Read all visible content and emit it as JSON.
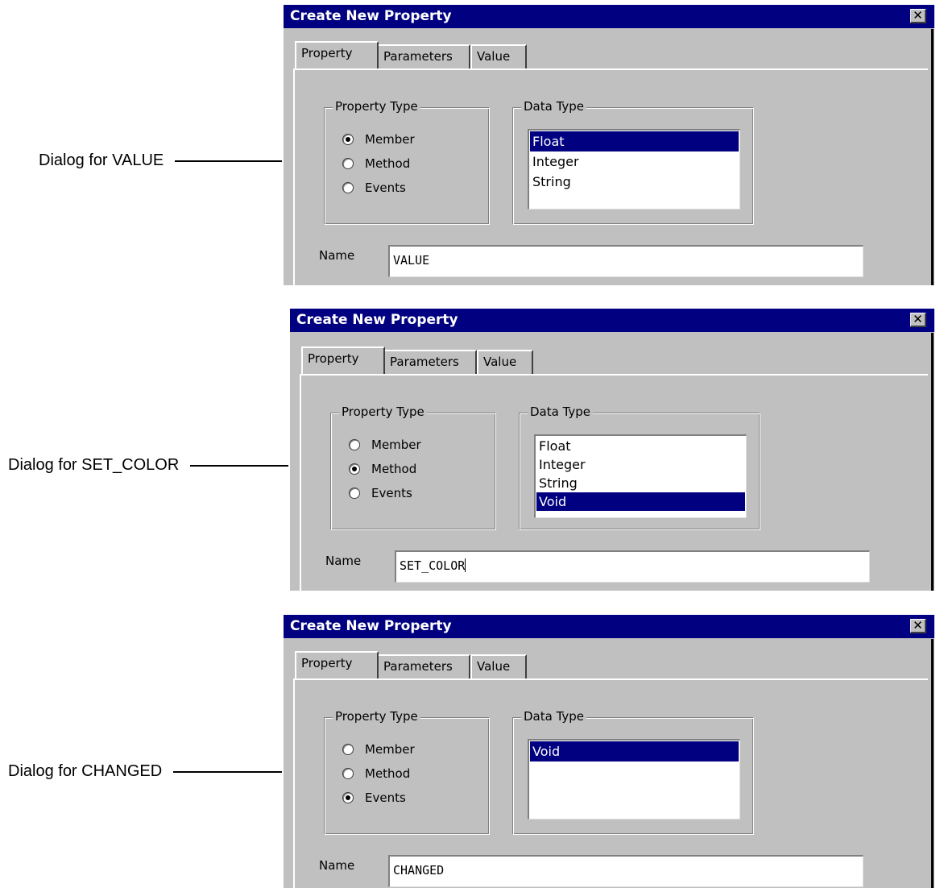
{
  "dialogs": [
    {
      "caption": "Dialog for VALUE",
      "title": "Create New Property",
      "close_glyph": "✕",
      "tabs": [
        "Property",
        "Parameters",
        "Value"
      ],
      "active_tab": "Property",
      "property_type": {
        "legend": "Property Type",
        "options": [
          {
            "label": "Member",
            "checked": true
          },
          {
            "label": "Method",
            "checked": false
          },
          {
            "label": "Events",
            "checked": false
          }
        ]
      },
      "data_type": {
        "legend": "Data Type",
        "items": [
          {
            "label": "Float",
            "selected": true
          },
          {
            "label": "Integer",
            "selected": false
          },
          {
            "label": "String",
            "selected": false
          }
        ]
      },
      "name_label": "Name",
      "name_value": "VALUE",
      "name_has_caret": false
    },
    {
      "caption": "Dialog for SET_COLOR",
      "title": "Create New Property",
      "close_glyph": "✕",
      "tabs": [
        "Property",
        "Parameters",
        "Value"
      ],
      "active_tab": "Property",
      "property_type": {
        "legend": "Property Type",
        "options": [
          {
            "label": "Member",
            "checked": false
          },
          {
            "label": "Method",
            "checked": true
          },
          {
            "label": "Events",
            "checked": false
          }
        ]
      },
      "data_type": {
        "legend": "Data Type",
        "items": [
          {
            "label": "Float",
            "selected": false
          },
          {
            "label": "Integer",
            "selected": false
          },
          {
            "label": "String",
            "selected": false
          },
          {
            "label": "Void",
            "selected": true
          }
        ]
      },
      "name_label": "Name",
      "name_value": "SET_COLOR",
      "name_has_caret": true
    },
    {
      "caption": "Dialog for CHANGED",
      "title": "Create New Property",
      "close_glyph": "✕",
      "tabs": [
        "Property",
        "Parameters",
        "Value"
      ],
      "active_tab": "Property",
      "property_type": {
        "legend": "Property Type",
        "options": [
          {
            "label": "Member",
            "checked": false
          },
          {
            "label": "Method",
            "checked": false
          },
          {
            "label": "Events",
            "checked": true
          }
        ]
      },
      "data_type": {
        "legend": "Data Type",
        "items": [
          {
            "label": "Void",
            "selected": true
          }
        ]
      },
      "name_label": "Name",
      "name_value": "CHANGED",
      "name_has_caret": false
    }
  ],
  "colors": {
    "title_bar": "#000080",
    "face": "#c0c0c0",
    "selection": "#000080"
  },
  "icons": {
    "close": "close-icon",
    "radio": "radio-button-icon"
  }
}
